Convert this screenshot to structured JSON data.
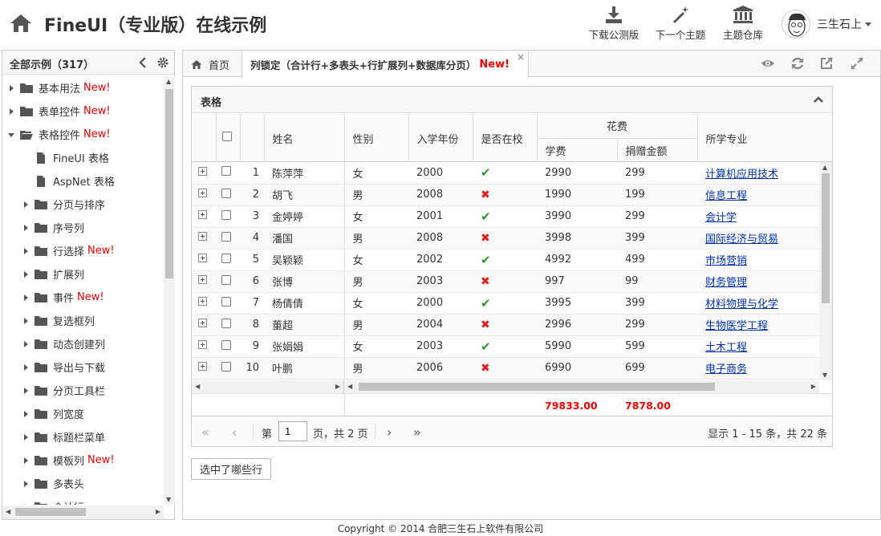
{
  "header": {
    "title": "FineUI（专业版）在线示例",
    "buttons": [
      {
        "label": "下载公测版",
        "icon": "download-icon"
      },
      {
        "label": "下一个主题",
        "icon": "magic-wand-icon"
      },
      {
        "label": "主题仓库",
        "icon": "bank-icon"
      }
    ],
    "user_name": "三生石上"
  },
  "sidebar": {
    "title": "全部示例（317）",
    "items": [
      {
        "label": "基本用法",
        "new": "New!"
      },
      {
        "label": "表单控件",
        "new": "New!"
      },
      {
        "label": "表格控件",
        "new": "New!"
      },
      {
        "label": "FineUI 表格",
        "new": ""
      },
      {
        "label": "AspNet 表格",
        "new": ""
      },
      {
        "label": "分页与排序",
        "new": ""
      },
      {
        "label": "序号列",
        "new": ""
      },
      {
        "label": "行选择",
        "new": "New!"
      },
      {
        "label": "扩展列",
        "new": ""
      },
      {
        "label": "事件",
        "new": "New!"
      },
      {
        "label": "复选框列",
        "new": ""
      },
      {
        "label": "动态创建列",
        "new": ""
      },
      {
        "label": "导出与下载",
        "new": ""
      },
      {
        "label": "分页工具栏",
        "new": ""
      },
      {
        "label": "列宽度",
        "new": ""
      },
      {
        "label": "标题栏菜单",
        "new": ""
      },
      {
        "label": "模板列",
        "new": "New!"
      },
      {
        "label": "多表头",
        "new": ""
      },
      {
        "label": "合计行",
        "new": ""
      }
    ]
  },
  "tabs": {
    "home": "首页",
    "active": "列锁定（合计行+多表头+行扩展列+数据库分页）",
    "active_new": "New!",
    "close": "×"
  },
  "panel": {
    "title": "表格",
    "columns": {
      "name": "姓名",
      "gender": "性别",
      "year": "入学年份",
      "inschool": "是否在校",
      "fee_group": "花费",
      "tuition": "学费",
      "donation": "捐赠金额",
      "major": "所学专业"
    },
    "rows": [
      {
        "no": "1",
        "name": "陈萍萍",
        "gender": "女",
        "year": "2000",
        "inschool": true,
        "tuition": "2990",
        "donation": "299",
        "major": "计算机应用技术"
      },
      {
        "no": "2",
        "name": "胡飞",
        "gender": "男",
        "year": "2008",
        "inschool": false,
        "tuition": "1990",
        "donation": "199",
        "major": "信息工程"
      },
      {
        "no": "3",
        "name": "金婷婷",
        "gender": "女",
        "year": "2001",
        "inschool": true,
        "tuition": "3990",
        "donation": "299",
        "major": "会计学"
      },
      {
        "no": "4",
        "name": "潘国",
        "gender": "男",
        "year": "2008",
        "inschool": false,
        "tuition": "3998",
        "donation": "399",
        "major": "国际经济与贸易"
      },
      {
        "no": "5",
        "name": "吴颖颖",
        "gender": "女",
        "year": "2002",
        "inschool": true,
        "tuition": "4992",
        "donation": "499",
        "major": "市场营销"
      },
      {
        "no": "6",
        "name": "张博",
        "gender": "男",
        "year": "2003",
        "inschool": false,
        "tuition": "997",
        "donation": "99",
        "major": "财务管理"
      },
      {
        "no": "7",
        "name": "杨倩倩",
        "gender": "女",
        "year": "2000",
        "inschool": true,
        "tuition": "3995",
        "donation": "399",
        "major": "材料物理与化学"
      },
      {
        "no": "8",
        "name": "董超",
        "gender": "男",
        "year": "2004",
        "inschool": false,
        "tuition": "2996",
        "donation": "299",
        "major": "生物医学工程"
      },
      {
        "no": "9",
        "name": "张娟娟",
        "gender": "女",
        "year": "2003",
        "inschool": true,
        "tuition": "5990",
        "donation": "599",
        "major": "土木工程"
      },
      {
        "no": "10",
        "name": "叶鹏",
        "gender": "男",
        "year": "2006",
        "inschool": false,
        "tuition": "6990",
        "donation": "699",
        "major": "电子商务"
      }
    ],
    "summary": {
      "tuition": "79833.00",
      "donation": "7878.00"
    },
    "pager": {
      "prefix": "第",
      "page": "1",
      "suffix": "页，共 2 页",
      "info": "显示 1 - 15 条，共 22 条"
    },
    "selected_button": "选中了哪些行"
  },
  "colors": {
    "new": "#ee0000",
    "check": "#2a9a2a",
    "cross": "#e02020",
    "link": "#0033aa"
  },
  "footer": "Copyright © 2014 合肥三生石上软件有限公司"
}
